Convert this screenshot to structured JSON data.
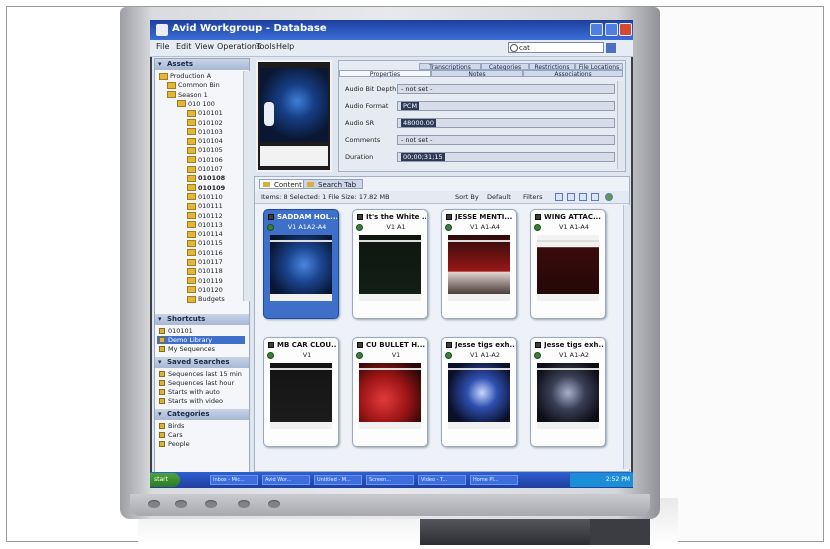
{
  "window": {
    "title": "Avid Workgroup - Database"
  },
  "menu": [
    "File",
    "Edit",
    "View",
    "Operations",
    "Tools",
    "Help"
  ],
  "search": {
    "value": "cat"
  },
  "left_panel": {
    "assets_header": "Assets",
    "tree": [
      {
        "label": "Production A",
        "level": 1
      },
      {
        "label": "Common Bin",
        "level": 2
      },
      {
        "label": "Season 1",
        "level": 2
      },
      {
        "label": "010 100",
        "level": 3
      },
      {
        "label": "010101",
        "level": 4
      },
      {
        "label": "010102",
        "level": 4
      },
      {
        "label": "010103",
        "level": 4
      },
      {
        "label": "010104",
        "level": 4
      },
      {
        "label": "010105",
        "level": 4
      },
      {
        "label": "010106",
        "level": 4
      },
      {
        "label": "010107",
        "level": 4
      },
      {
        "label": "010108",
        "level": 4
      },
      {
        "label": "010109",
        "level": 4
      },
      {
        "label": "010110",
        "level": 4
      },
      {
        "label": "010111",
        "level": 4
      },
      {
        "label": "010112",
        "level": 4
      },
      {
        "label": "010113",
        "level": 4
      },
      {
        "label": "010114",
        "level": 4
      },
      {
        "label": "010115",
        "level": 4
      },
      {
        "label": "010116",
        "level": 4
      },
      {
        "label": "010117",
        "level": 4
      },
      {
        "label": "010118",
        "level": 4
      },
      {
        "label": "010119",
        "level": 4
      },
      {
        "label": "010120",
        "level": 4
      },
      {
        "label": "Budgets",
        "level": 4
      }
    ],
    "shortcuts_header": "Shortcuts",
    "shortcuts": [
      "010101",
      "Demo Library",
      "My Sequences"
    ],
    "saved_searches_header": "Saved Searches",
    "saved_searches": [
      "Sequences last 15 min",
      "Sequences last hour",
      "Starts with auto",
      "Starts with video"
    ],
    "categories_header": "Categories",
    "categories": [
      "Birds",
      "Cars",
      "People"
    ]
  },
  "properties": {
    "tabs_top": [
      "Transcriptions",
      "Categories",
      "Restrictions",
      "File Locations"
    ],
    "tabs_bottom": [
      "Properties",
      "Notes",
      "Associations"
    ],
    "fields": [
      {
        "label": "Audio Bit Depth",
        "value": "- not set -"
      },
      {
        "label": "Audio Format",
        "value": "PCM"
      },
      {
        "label": "Audio SR",
        "value": "48000.00"
      },
      {
        "label": "Comments",
        "value": "- not set -"
      },
      {
        "label": "Duration",
        "value": "00;00;31;15"
      }
    ]
  },
  "content": {
    "tabs": [
      "Content",
      "Search Tab"
    ],
    "status": "Items: 8 Selected: 1 File Size: 17.82 MB",
    "sort_label": "Sort By",
    "default_label": "Default",
    "filters_label": "Filters",
    "tiles": [
      {
        "title": "SADDAM HOL...",
        "sub": "V1 A1A2-A4",
        "selected": true,
        "thumb": "dark-blue"
      },
      {
        "title": "It's the White ...",
        "sub": "V1 A1",
        "selected": false,
        "thumb": "dark-green"
      },
      {
        "title": "JESSE MENTI...",
        "sub": "V1 A1-A4",
        "selected": false,
        "thumb": "red-car"
      },
      {
        "title": "WING ATTAC...",
        "sub": "V1 A1-A4",
        "selected": false,
        "thumb": "dark-red"
      },
      {
        "title": "MB CAR CLOU...",
        "sub": "V1",
        "selected": false,
        "thumb": "dark-gray"
      },
      {
        "title": "CU BULLET H...",
        "sub": "V1",
        "selected": false,
        "thumb": "red-bright"
      },
      {
        "title": "Jesse tigs exh...",
        "sub": "V1 A1-A2",
        "selected": false,
        "thumb": "night-blue"
      },
      {
        "title": "Jesse tigs exh...",
        "sub": "V1 A1-A2",
        "selected": false,
        "thumb": "night-dark"
      }
    ]
  },
  "taskbar": {
    "start": "start",
    "tasks": [
      "Inbox - Mic...",
      "Avid Wor...",
      "Untitled - M...",
      "Screen...",
      "Video - T...",
      "Home Pl..."
    ],
    "tray_time": "2:52 PM"
  },
  "colors": {
    "titlebar": "#1c3f9b",
    "selection": "#3e6fc9",
    "taskbar": "#2f5fd1",
    "start": "#3b8f30"
  }
}
